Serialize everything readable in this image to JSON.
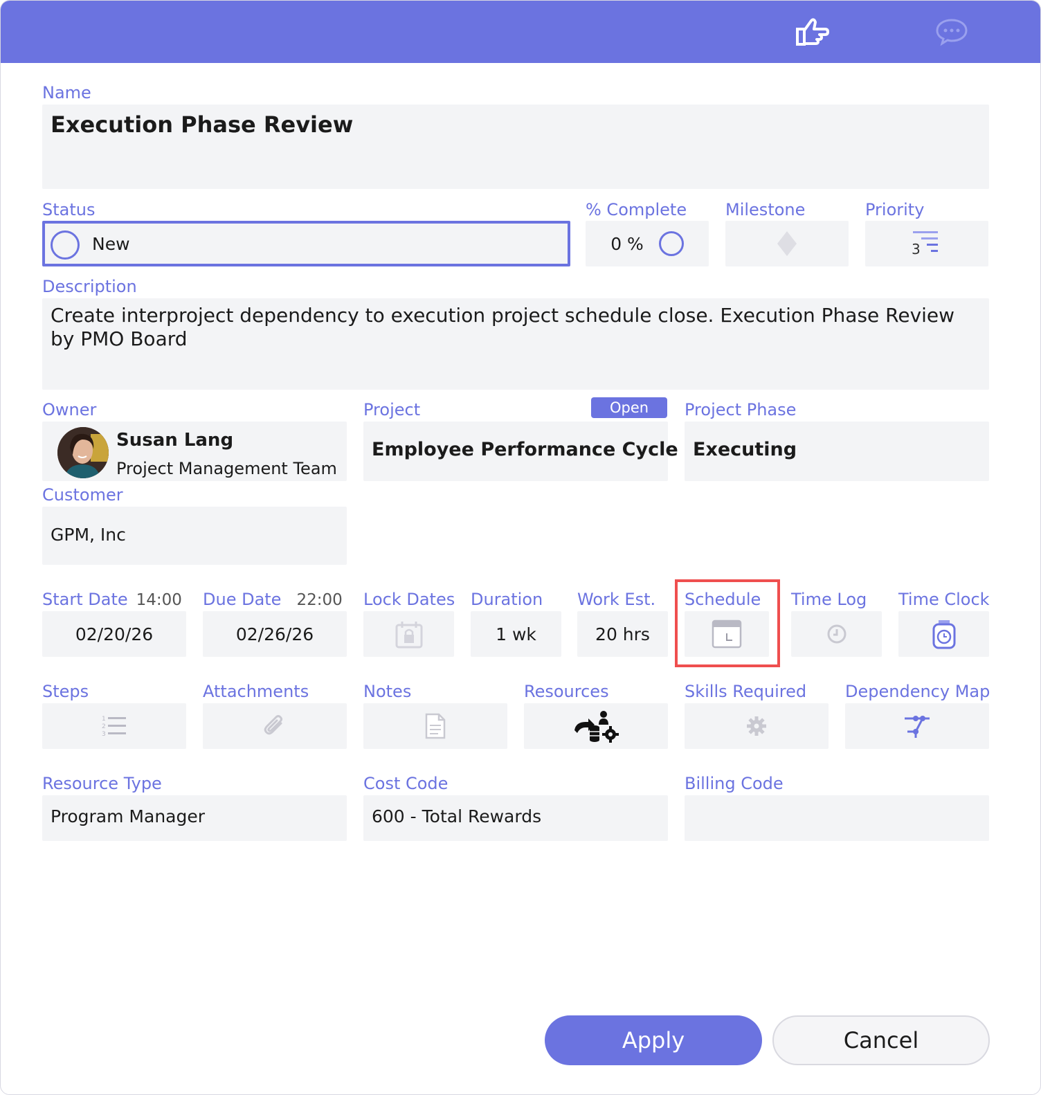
{
  "header": {
    "icons": [
      "thumbs-up-icon",
      "chat-icon"
    ]
  },
  "fields": {
    "name": {
      "label": "Name",
      "value": "Execution Phase Review"
    },
    "status": {
      "label": "Status",
      "value": "New"
    },
    "percent_complete": {
      "label": "% Complete",
      "value": "0 %"
    },
    "milestone": {
      "label": "Milestone"
    },
    "priority": {
      "label": "Priority",
      "value": "3"
    },
    "description": {
      "label": "Description",
      "value": "Create interproject dependency to execution project schedule close. Execution Phase Review by PMO Board"
    },
    "owner": {
      "label": "Owner",
      "name": "Susan Lang",
      "team": "Project Management Team"
    },
    "project": {
      "label": "Project",
      "badge": "Open",
      "value": "Employee Performance Cycle"
    },
    "project_phase": {
      "label": "Project Phase",
      "value": "Executing"
    },
    "customer": {
      "label": "Customer",
      "value": "GPM, Inc"
    },
    "start_date": {
      "label": "Start Date",
      "time": "14:00",
      "value": "02/20/26"
    },
    "due_date": {
      "label": "Due Date",
      "time": "22:00",
      "value": "02/26/26"
    },
    "lock_dates": {
      "label": "Lock Dates"
    },
    "duration": {
      "label": "Duration",
      "value": "1 wk"
    },
    "work_est": {
      "label": "Work Est.",
      "value": "20 hrs"
    },
    "schedule": {
      "label": "Schedule"
    },
    "time_log": {
      "label": "Time Log"
    },
    "time_clock": {
      "label": "Time Clock"
    },
    "steps": {
      "label": "Steps"
    },
    "attachments": {
      "label": "Attachments"
    },
    "notes": {
      "label": "Notes"
    },
    "resources": {
      "label": "Resources"
    },
    "skills_required": {
      "label": "Skills Required"
    },
    "dependency_map": {
      "label": "Dependency Map"
    },
    "resource_type": {
      "label": "Resource Type",
      "value": "Program Manager"
    },
    "cost_code": {
      "label": "Cost Code",
      "value": "600 - Total Rewards"
    },
    "billing_code": {
      "label": "Billing Code",
      "value": ""
    }
  },
  "buttons": {
    "apply": "Apply",
    "cancel": "Cancel"
  },
  "colors": {
    "accent": "#6b73e0",
    "field_bg": "#f3f4f6",
    "highlight": "#ef4f4f"
  }
}
